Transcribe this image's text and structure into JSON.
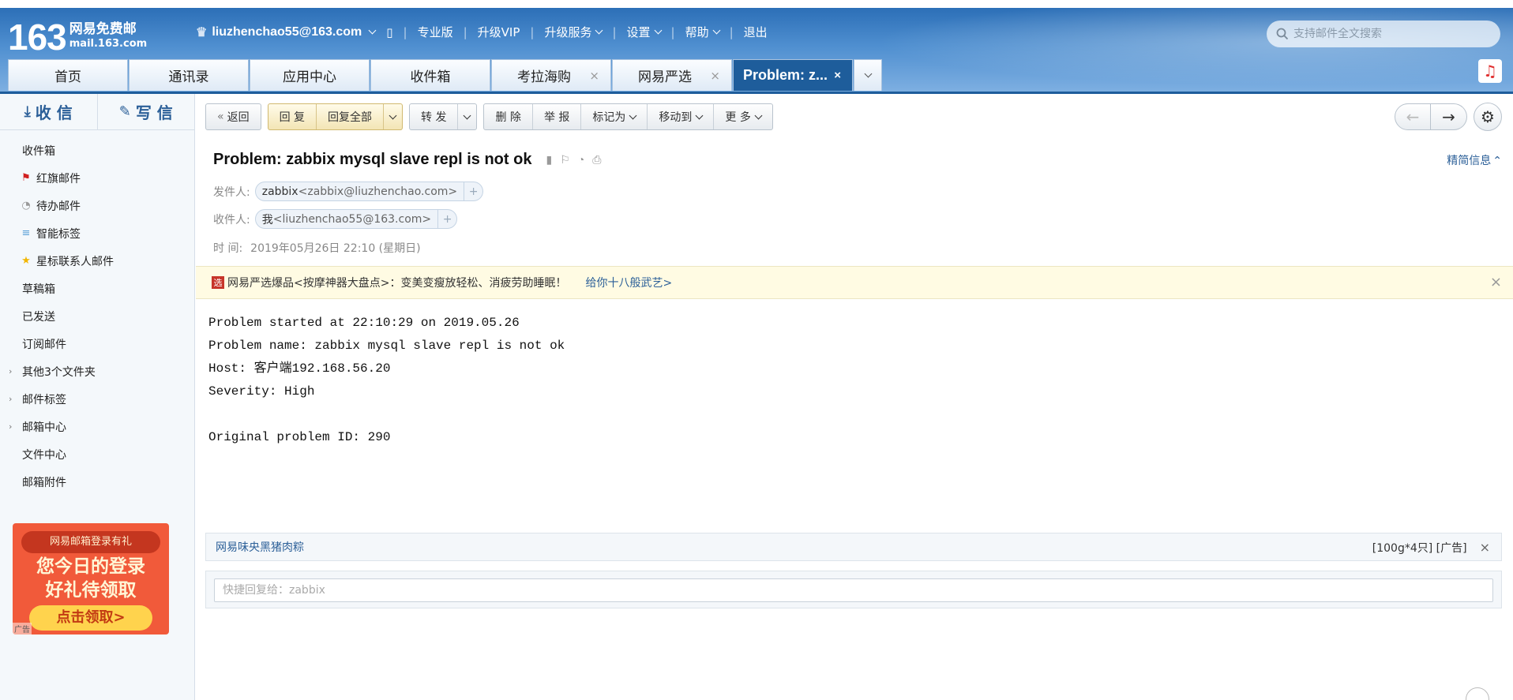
{
  "logo": {
    "number": "163",
    "name": "网易免费邮",
    "domain": "mail.163.com"
  },
  "topnav": {
    "user": "liuzhenchao55@163.com",
    "items": [
      "专业版",
      "升级VIP",
      "升级服务",
      "设置",
      "帮助",
      "退出"
    ]
  },
  "search": {
    "placeholder": "支持邮件全文搜索"
  },
  "tabs": [
    {
      "label": "首页"
    },
    {
      "label": "通讯录"
    },
    {
      "label": "应用中心"
    },
    {
      "label": "收件箱"
    },
    {
      "label": "考拉海购",
      "close": "×"
    },
    {
      "label": "网易严选",
      "close": "×"
    },
    {
      "label": "Problem: z...",
      "close": "×",
      "active": true
    }
  ],
  "sidebar": {
    "receive": "收 信",
    "write": "写 信",
    "folders": [
      {
        "label": "收件箱"
      },
      {
        "label": "红旗邮件",
        "icon": "flag-icon"
      },
      {
        "label": "待办邮件",
        "icon": "clock-icon"
      },
      {
        "label": "智能标签",
        "icon": "tag-icon"
      },
      {
        "label": "星标联系人邮件",
        "icon": "star-icon"
      },
      {
        "label": "草稿箱"
      },
      {
        "label": "已发送"
      },
      {
        "label": "订阅邮件"
      },
      {
        "label": "其他3个文件夹",
        "expandable": true
      },
      {
        "label": "邮件标签",
        "expandable": true
      },
      {
        "label": "邮箱中心",
        "expandable": true
      },
      {
        "label": "文件中心"
      },
      {
        "label": "邮箱附件"
      }
    ],
    "promo": {
      "line1": "网易邮箱登录有礼",
      "line2": "您今日的登录",
      "line3": "好礼待领取",
      "button": "点击领取>",
      "ad": "广告"
    }
  },
  "toolbar": {
    "back": "返回",
    "reply": "回 复",
    "reply_all": "回复全部",
    "forward": "转 发",
    "delete": "删 除",
    "report": "举 报",
    "mark_as": "标记为",
    "move_to": "移动到",
    "more": "更 多"
  },
  "mail": {
    "subject": "Problem: zabbix mysql slave repl is not ok",
    "brief_label": "精简信息",
    "from_label": "发件人:",
    "from_name": "zabbix",
    "from_addr": "<zabbix@liuzhenchao.com>",
    "to_label": "收件人:",
    "to_name": "我",
    "to_addr": "<liuzhenchao55@163.com>",
    "time_label": "时 间:",
    "time_value": "2019年05月26日 22:10 (星期日)",
    "body": [
      "Problem started at 22:10:29 on 2019.05.26",
      "Problem name: zabbix mysql slave repl is not ok",
      "Host: 客户端192.168.56.20",
      "Severity: High",
      "",
      "Original problem ID: 290"
    ]
  },
  "ad_top": {
    "badge": "选",
    "text": "网易严选爆品<按摩神器大盘点>：变美变瘦放轻松、消疲劳助睡眠！",
    "link": "给你十八般武艺>"
  },
  "ad_bottom": {
    "link": "网易味央黑猪肉粽",
    "detail": "[100g*4只] [广告]"
  },
  "quick_reply": {
    "placeholder": "快捷回复给：zabbix"
  }
}
